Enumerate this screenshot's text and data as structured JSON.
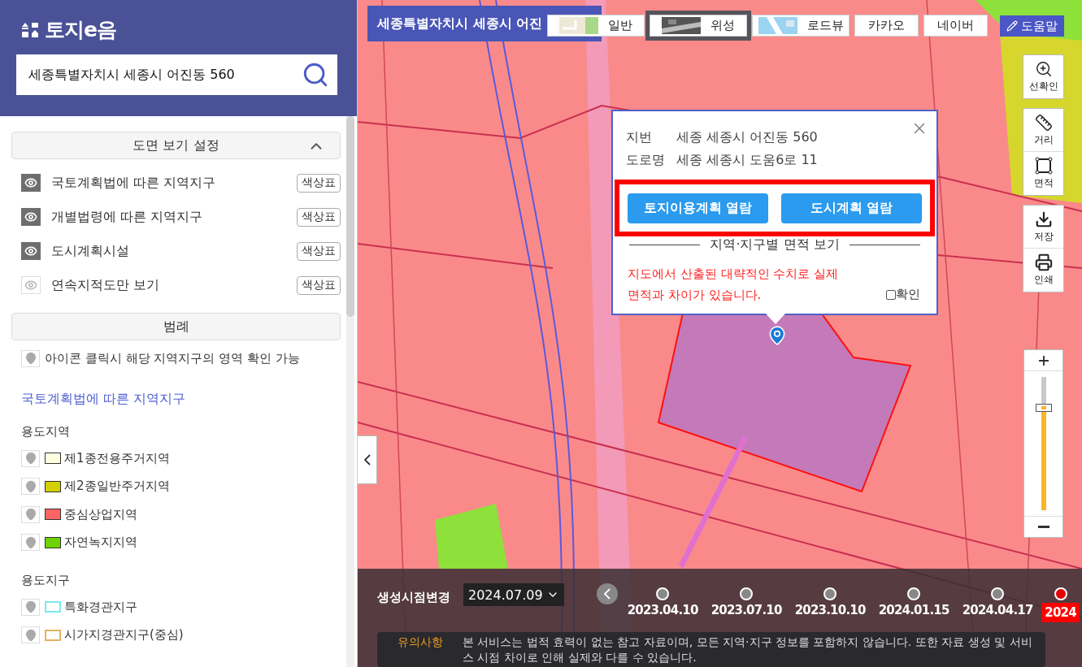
{
  "sidebar": {
    "logo": "토지e음",
    "search": {
      "value": "세종특별자치시 세종시 어진동 560"
    },
    "settings": {
      "title": "도면 보기 설정",
      "expanded": true,
      "layers": [
        {
          "label": "국토계획법에 따른 지역지구",
          "visible": true,
          "button": "색상표"
        },
        {
          "label": "개별법령에 따른 지역지구",
          "visible": true,
          "button": "색상표"
        },
        {
          "label": "도시계획시설",
          "visible": true,
          "button": "색상표"
        },
        {
          "label": "연속지적도만 보기",
          "visible": false,
          "button": "색상표"
        }
      ]
    },
    "legend": {
      "title": "범례",
      "note": "아이콘 클릭시 해당 지역지구의 영역 확인 가능",
      "heading": "국토계획법에 따른 지역지구",
      "groups": [
        {
          "title": "용도지역",
          "items": [
            {
              "label": "제1종전용주거지역",
              "kind": "fill",
              "color": "#ffffe0"
            },
            {
              "label": "제2종일반주거지역",
              "kind": "fill",
              "color": "#d4d000"
            },
            {
              "label": "중심상업지역",
              "kind": "fill",
              "color": "#ff6464"
            },
            {
              "label": "자연녹지지역",
              "kind": "fill",
              "color": "#6ed400"
            }
          ]
        },
        {
          "title": "용도지구",
          "items": [
            {
              "label": "특화경관지구",
              "kind": "outline",
              "color": "#7ee8ee"
            },
            {
              "label": "시가지경관지구(중심)",
              "kind": "outline",
              "color": "#e8b060"
            }
          ]
        }
      ]
    }
  },
  "map": {
    "location_title": "세종특별자치시 세종시 어진",
    "map_types": [
      {
        "label": "일반",
        "kind": "map",
        "selected": false
      },
      {
        "label": "위성",
        "kind": "satellite",
        "selected": true
      },
      {
        "label": "로드뷰",
        "kind": "roadview",
        "selected": false
      },
      {
        "label": "카카오",
        "kind": "text",
        "selected": false
      },
      {
        "label": "네이버",
        "kind": "text",
        "selected": false
      }
    ],
    "help_button": "도움말",
    "tool_groups": [
      {
        "tools": [
          {
            "label": "선확인",
            "kind": "check"
          }
        ]
      },
      {
        "tools": [
          {
            "label": "거리",
            "kind": "distance"
          },
          {
            "label": "면적",
            "kind": "area"
          }
        ]
      },
      {
        "tools": [
          {
            "label": "저장",
            "kind": "save"
          },
          {
            "label": "인쇄",
            "kind": "print"
          }
        ]
      }
    ],
    "zoom": {
      "level": 0.77
    },
    "popup": {
      "rows": [
        {
          "label": "지번",
          "value": "세종 세종시 어진동 560"
        },
        {
          "label": "도로명",
          "value": "세종 세종시 도움6로 11"
        }
      ],
      "highlighted": true,
      "buttons": [
        "토지이용계획 열람",
        "도시계획 열람"
      ],
      "section_title": "지역·지구별 면적 보기",
      "warning": "지도에서 산출된 대략적인 수치로 실제 면적과 차이가 있습니다.",
      "confirm": {
        "label": "확인",
        "checked": false
      }
    },
    "timeline": {
      "label": "생성시점변경",
      "selected_date": "2024.07.09",
      "dates": [
        {
          "label": "2023.04.10",
          "selected": false
        },
        {
          "label": "2023.07.10",
          "selected": false
        },
        {
          "label": "2023.10.10",
          "selected": false
        },
        {
          "label": "2024.01.15",
          "selected": false
        },
        {
          "label": "2024.04.17",
          "selected": false
        },
        {
          "label": "2024",
          "selected": true
        }
      ]
    },
    "notice": {
      "title": "유의사항",
      "text": "본 서비스는 법적 효력이 없는 참고 자료이며, 모든 지역·지구 정보를 포함하지 않습니다. 또한 자료 생성 및 서비스 시점 차이로 인해 실제와 다를 수 있습니다."
    }
  }
}
